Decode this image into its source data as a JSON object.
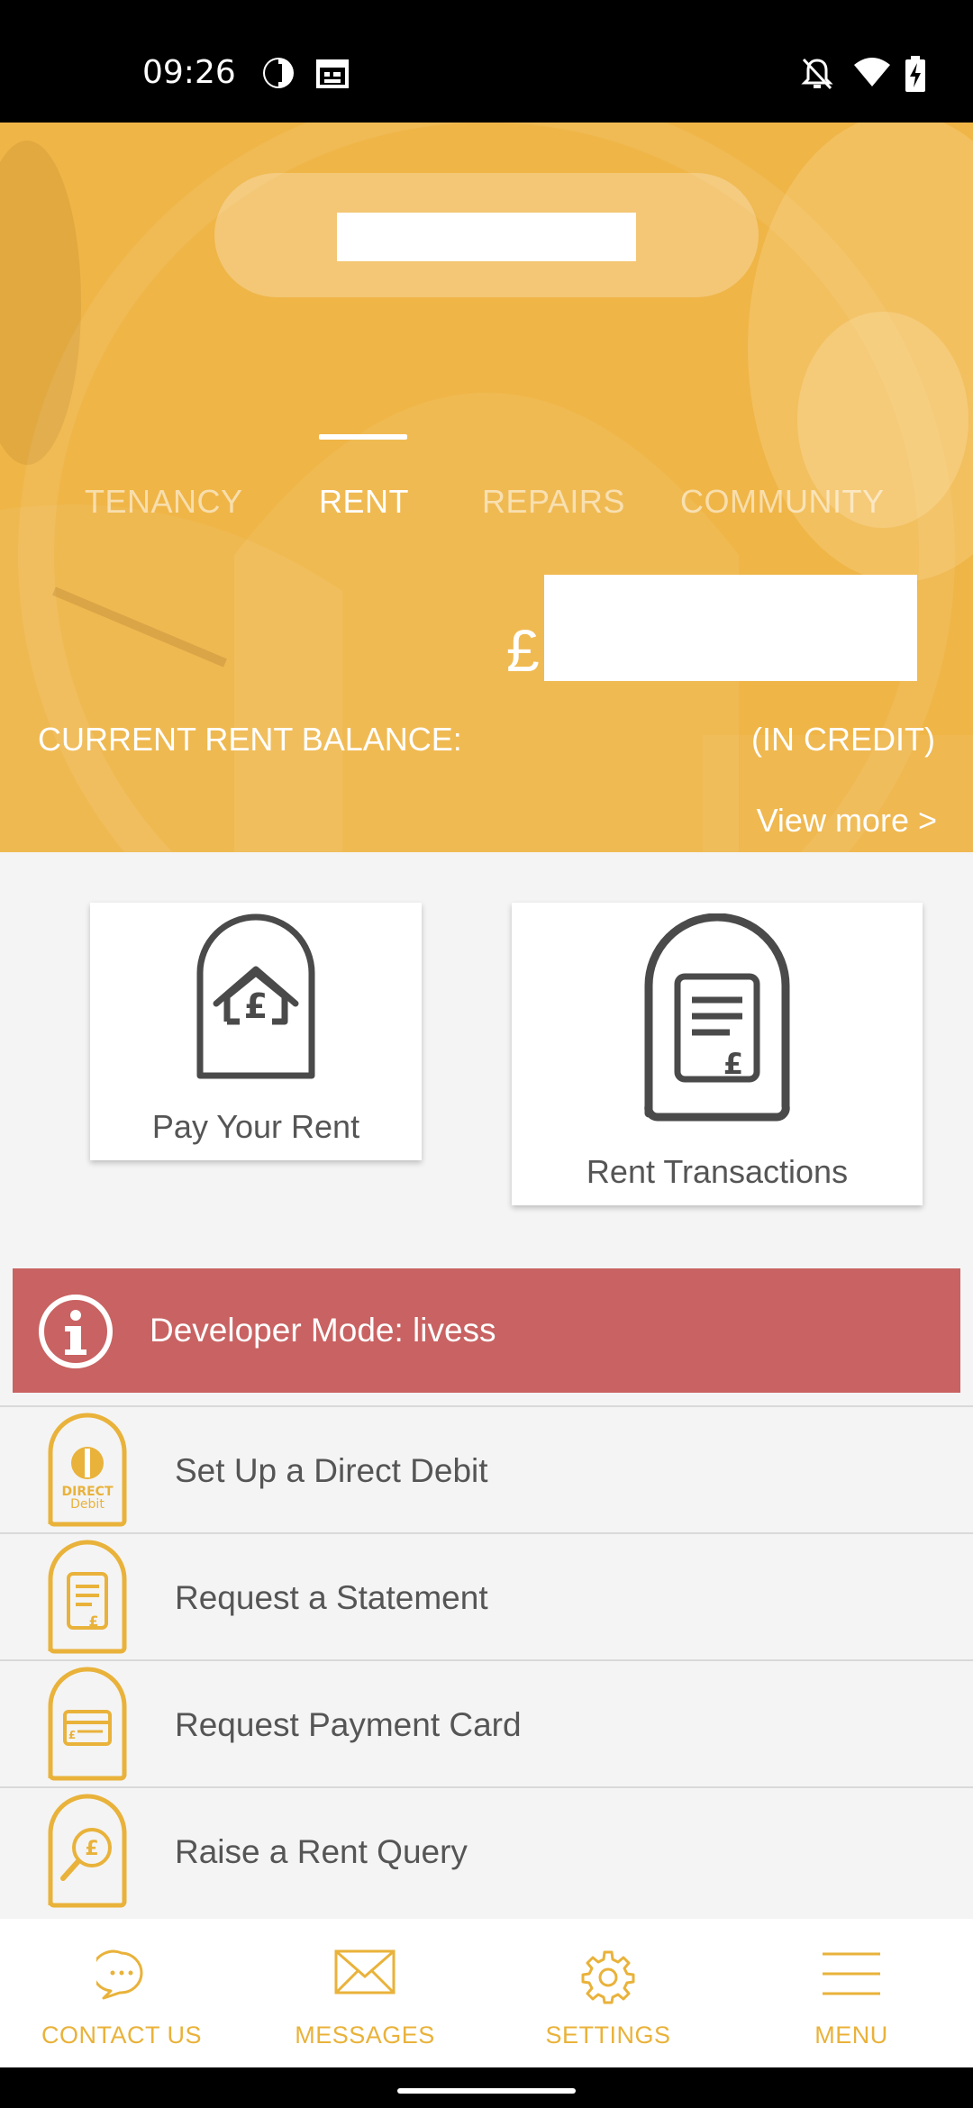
{
  "status_bar": {
    "time": "09:26"
  },
  "hero": {
    "tabs": [
      {
        "label": "TENANCY"
      },
      {
        "label": "RENT"
      },
      {
        "label": "REPAIRS"
      },
      {
        "label": "COMMUNITY"
      }
    ],
    "active_tab": "RENT",
    "currency_symbol": "£",
    "balance_label": "CURRENT RENT BALANCE:",
    "balance_status": "(IN CREDIT)",
    "view_more": "View more >"
  },
  "cards": [
    {
      "label": "Pay Your Rent",
      "icon": "house-pound-icon"
    },
    {
      "label": "Rent Transactions",
      "icon": "document-pound-icon"
    }
  ],
  "dev_banner": {
    "text": "Developer Mode: livess",
    "icon": "info-icon"
  },
  "list": [
    {
      "label": "Set Up a Direct Debit",
      "icon": "direct-debit-icon"
    },
    {
      "label": "Request a Statement",
      "icon": "statement-icon"
    },
    {
      "label": "Request Payment Card",
      "icon": "payment-card-icon"
    },
    {
      "label": "Raise a Rent Query",
      "icon": "search-pound-icon"
    }
  ],
  "bottom_nav": [
    {
      "label": "CONTACT US",
      "icon": "chat-bubble-icon"
    },
    {
      "label": "MESSAGES",
      "icon": "envelope-icon"
    },
    {
      "label": "SETTINGS",
      "icon": "gear-icon"
    },
    {
      "label": "MENU",
      "icon": "hamburger-icon"
    }
  ],
  "colors": {
    "brand": "#efb648",
    "accent": "#e9b23a",
    "banner": "#c96262",
    "icon_dark": "#4a4a4a"
  }
}
